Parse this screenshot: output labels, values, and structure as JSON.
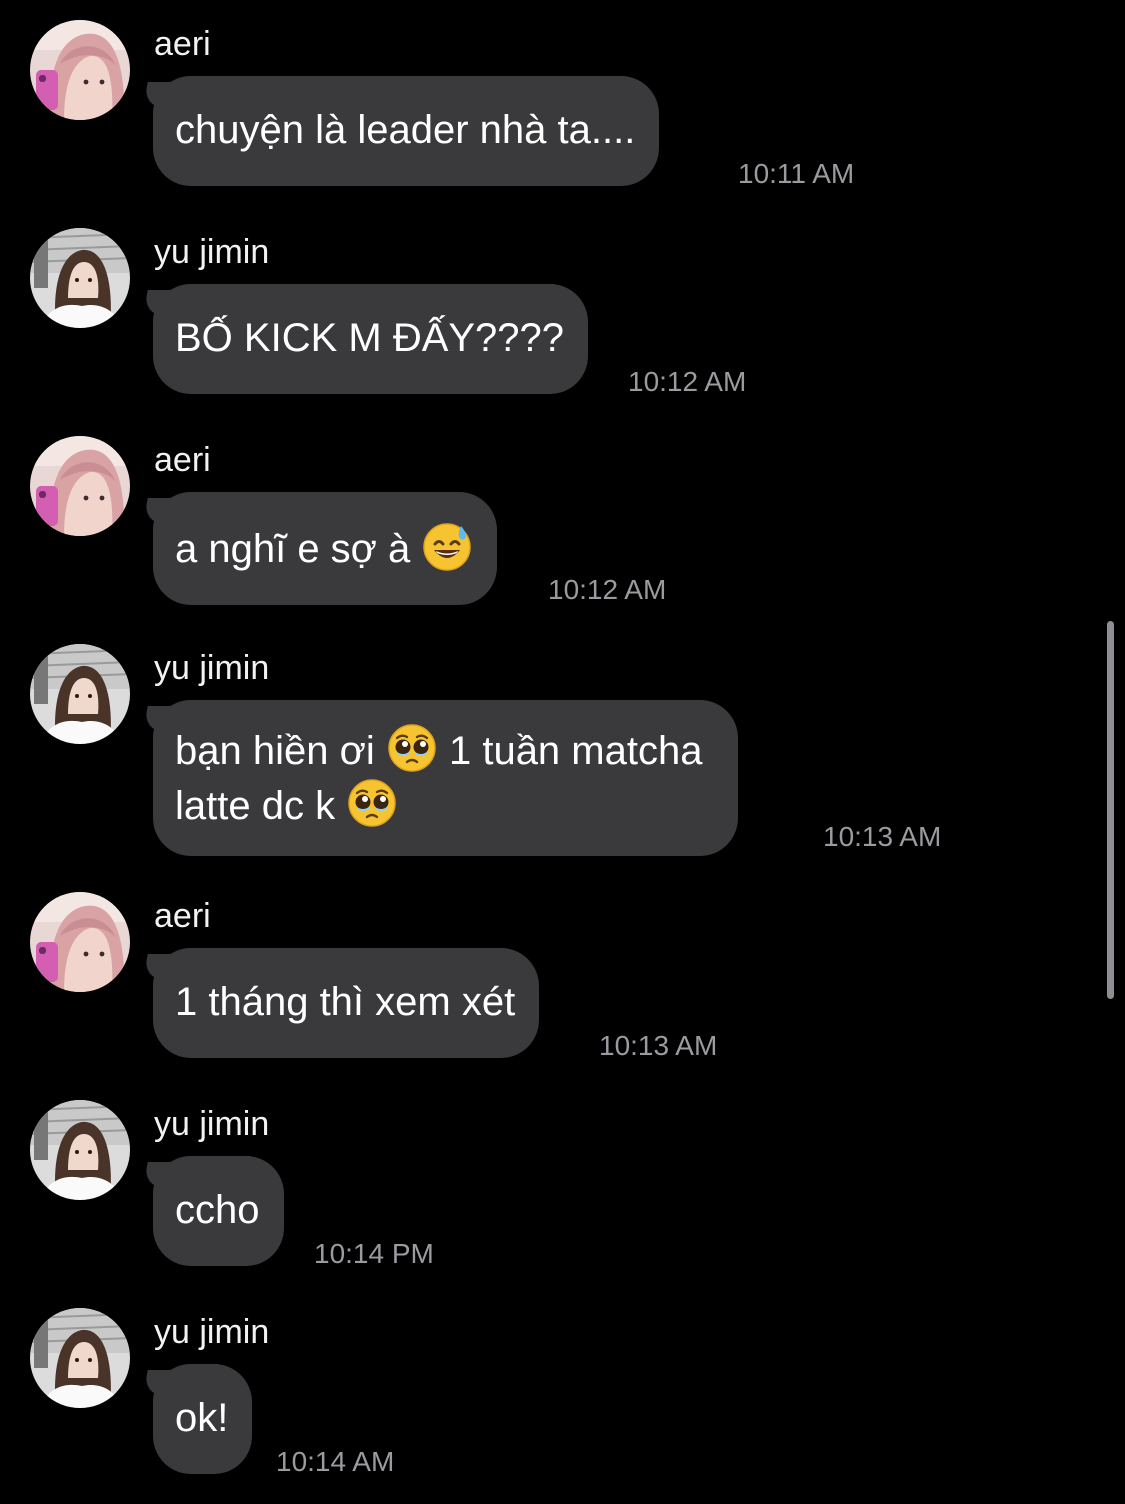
{
  "messages": [
    {
      "sender": "aeri",
      "avatar_icon": "avatar-aeri",
      "text": "chuyện là leader nhà ta....",
      "time": "10:11 AM"
    },
    {
      "sender": "yu jimin",
      "avatar_icon": "avatar-yu-jimin",
      "text": "BỐ KICK M ĐẤY????",
      "time": "10:12 AM"
    },
    {
      "sender": "aeri",
      "avatar_icon": "avatar-aeri",
      "text": "a nghĩ e sợ à",
      "emoji": "grinning-face-with-sweat-icon",
      "time": "10:12 AM"
    },
    {
      "sender": "yu jimin",
      "avatar_icon": "avatar-yu-jimin",
      "line1_a": "bạn hiền ơi",
      "line1_b": "1 tuần matcha",
      "line2": "latte dc k",
      "emoji": "pleading-face-icon",
      "time": "10:13 AM"
    },
    {
      "sender": "aeri",
      "avatar_icon": "avatar-aeri",
      "text": "1 tháng thì xem xét",
      "time": "10:13 AM"
    },
    {
      "sender": "yu jimin",
      "avatar_icon": "avatar-yu-jimin",
      "text": "ccho",
      "time": "10:14 PM"
    },
    {
      "sender": "yu jimin",
      "avatar_icon": "avatar-yu-jimin",
      "text": "ok!",
      "time": "10:14 AM"
    }
  ],
  "colors": {
    "background": "#000000",
    "bubble": "#3a3a3c",
    "timestamp": "#9a9a9f",
    "scrollbar": "#8e8e93"
  }
}
